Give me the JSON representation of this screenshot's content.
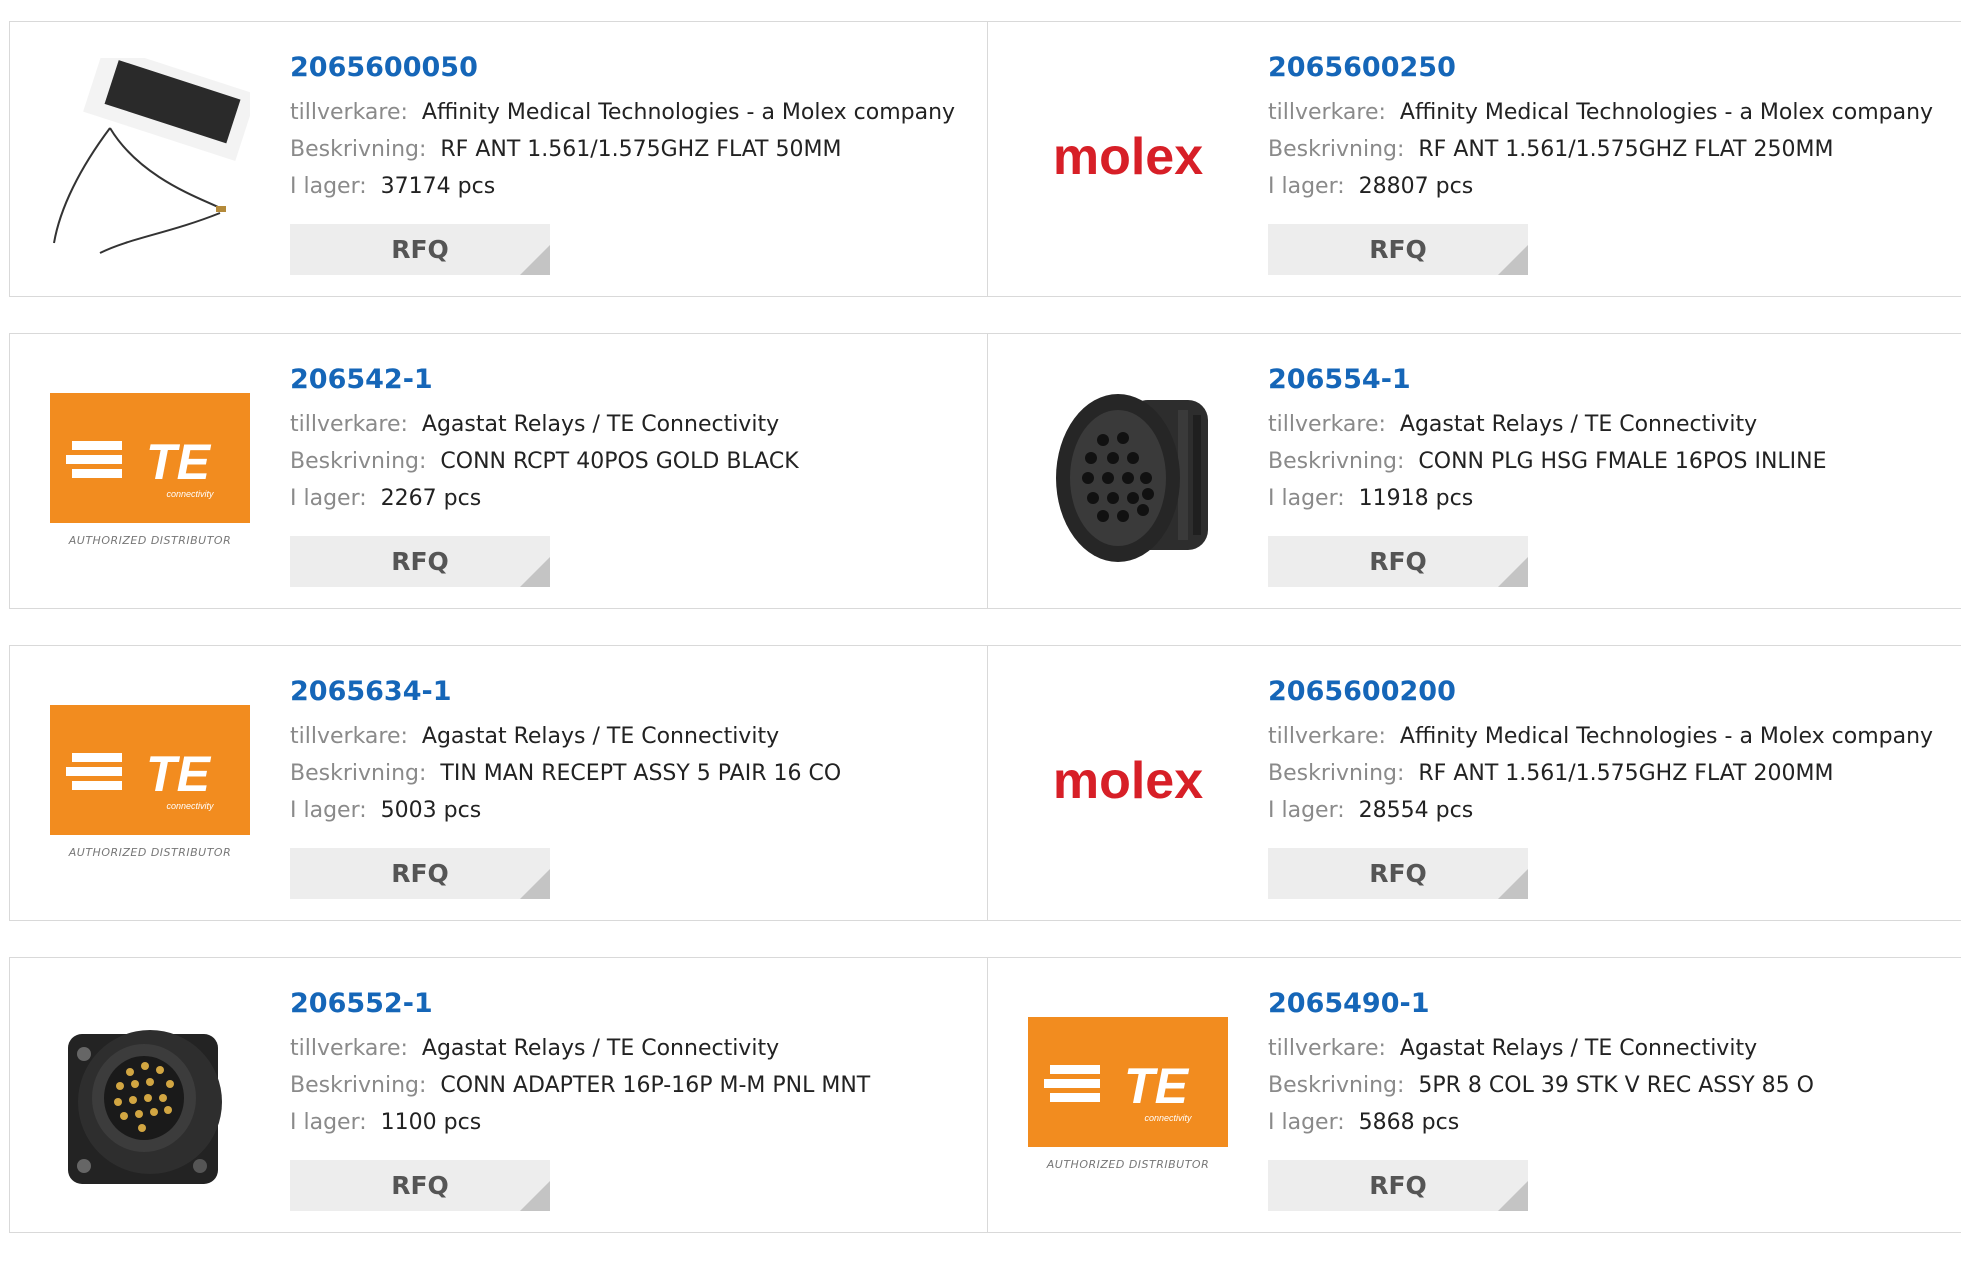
{
  "labels": {
    "manufacturer": "tillverkare:",
    "description": "Beskrivning:",
    "stock": "I lager:"
  },
  "rfq_label": "RFQ",
  "colors": {
    "link": "#1566b8",
    "te_orange": "#f28c1f",
    "molex_red": "#d71f27"
  },
  "logo_text": {
    "molex": "molex",
    "te": "TE",
    "te_connectivity": "connectivity",
    "authorized": "AUTHORIZED DISTRIBUTOR"
  },
  "products": [
    {
      "part": "2065600050",
      "manufacturer": "Affinity Medical Technologies - a Molex company",
      "description": "RF ANT 1.561/1.575GHZ FLAT 50MM",
      "stock": "37174 pcs",
      "image": "flat-antenna-image"
    },
    {
      "part": "2065600250",
      "manufacturer": "Affinity Medical Technologies - a Molex company",
      "description": "RF ANT 1.561/1.575GHZ FLAT 250MM",
      "stock": "28807 pcs",
      "image": "molex-logo"
    },
    {
      "part": "206542-1",
      "manufacturer": "Agastat Relays / TE Connectivity",
      "description": "CONN RCPT 40POS GOLD BLACK",
      "stock": "2267 pcs",
      "image": "te-logo"
    },
    {
      "part": "206554-1",
      "manufacturer": "Agastat Relays / TE Connectivity",
      "description": "CONN PLG HSG FMALE 16POS INLINE",
      "stock": "11918 pcs",
      "image": "circular-plug-image"
    },
    {
      "part": "2065634-1",
      "manufacturer": "Agastat Relays / TE Connectivity",
      "description": "TIN MAN RECEPT ASSY 5 PAIR 16 CO",
      "stock": "5003 pcs",
      "image": "te-logo"
    },
    {
      "part": "2065600200",
      "manufacturer": "Affinity Medical Technologies - a Molex company",
      "description": "RF ANT 1.561/1.575GHZ FLAT 200MM",
      "stock": "28554 pcs",
      "image": "molex-logo"
    },
    {
      "part": "206552-1",
      "manufacturer": "Agastat Relays / TE Connectivity",
      "description": "CONN ADAPTER 16P-16P M-M PNL MNT",
      "stock": "1100 pcs",
      "image": "panel-connector-image"
    },
    {
      "part": "2065490-1",
      "manufacturer": "Agastat Relays / TE Connectivity",
      "description": "5PR 8 COL 39 STK V REC ASSY 85 O",
      "stock": "5868 pcs",
      "image": "te-logo"
    }
  ]
}
